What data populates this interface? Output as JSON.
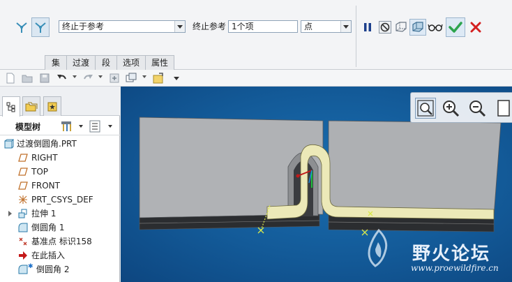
{
  "dashboard": {
    "type_dropdown": "终止于参考",
    "end_ref_label": "终止参考",
    "end_ref_value": "1个项",
    "point_dropdown": "点",
    "tabs": [
      {
        "label": "集"
      },
      {
        "label": "过渡"
      },
      {
        "label": "段"
      },
      {
        "label": "选项"
      },
      {
        "label": "属性"
      }
    ]
  },
  "left_panel": {
    "tree_title": "模型树",
    "items": [
      {
        "label": "过渡倒圆角.PRT",
        "icon": "part-icon"
      },
      {
        "label": "RIGHT",
        "icon": "datum-plane-icon"
      },
      {
        "label": "TOP",
        "icon": "datum-plane-icon"
      },
      {
        "label": "FRONT",
        "icon": "datum-plane-icon"
      },
      {
        "label": "PRT_CSYS_DEF",
        "icon": "csys-icon"
      },
      {
        "label": "拉伸 1",
        "icon": "extrude-icon"
      },
      {
        "label": "倒圆角 1",
        "icon": "round-icon"
      },
      {
        "label": "基准点 标识158",
        "icon": "datum-point-icon"
      },
      {
        "label": "在此插入",
        "icon": "insert-here-arrow-icon"
      },
      {
        "label": "倒圆角 2",
        "icon": "round-icon"
      }
    ]
  },
  "watermark": {
    "title": "野火论坛",
    "url": "www.proewildfire.cn"
  },
  "colors": {
    "viewport_bg": "#135a98",
    "ok_green": "#2da44e",
    "cancel_red": "#d42020",
    "pause_blue": "#1c3f8c"
  }
}
